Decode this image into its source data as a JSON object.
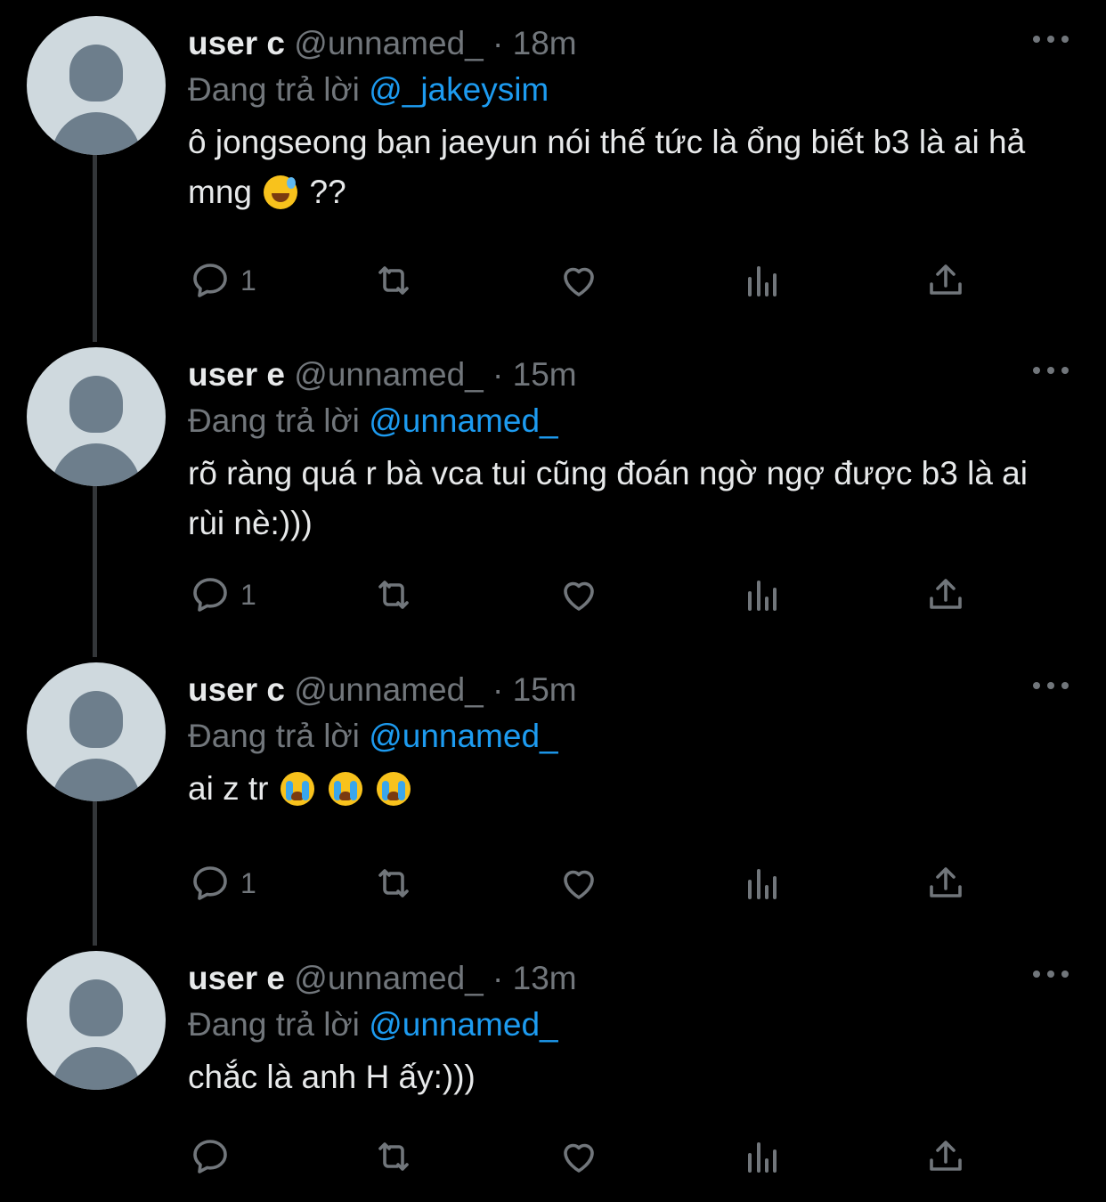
{
  "theme": {
    "background": "#000000",
    "text": "#e7e9ea",
    "muted": "#71767b",
    "accent": "#1d9bf0",
    "thread_line": "#333639"
  },
  "tweets": [
    {
      "name": "user c",
      "handle": "@unnamed_",
      "sep": "·",
      "time": "18m",
      "reply_prefix": "Đang trả lời",
      "reply_to": "@_jakeysim",
      "text": "ô jongseong bạn jaeyun nói thế tức là ổng biết b3 là ai hả mng",
      "emoji": [
        "sweat-smile-emoji"
      ],
      "text_suffix": "??",
      "reply_count": "1",
      "icons": [
        "reply-icon",
        "retweet-icon",
        "like-icon",
        "views-icon",
        "share-icon"
      ]
    },
    {
      "name": "user e",
      "handle": "@unnamed_",
      "sep": "·",
      "time": "15m",
      "reply_prefix": "Đang trả lời",
      "reply_to": "@unnamed_",
      "text": "rõ ràng quá r bà vca tui cũng đoán ngờ ngợ được b3 là ai rùi nè:)))",
      "reply_count": "1"
    },
    {
      "name": "user c",
      "handle": "@unnamed_",
      "sep": "·",
      "time": "15m",
      "reply_prefix": "Đang trả lời",
      "reply_to": "@unnamed_",
      "text": "ai z tr",
      "emoji": [
        "crying-emoji",
        "crying-emoji",
        "crying-emoji"
      ],
      "reply_count": "1"
    },
    {
      "name": "user e",
      "handle": "@unnamed_",
      "sep": "·",
      "time": "13m",
      "reply_prefix": "Đang trả lời",
      "reply_to": "@unnamed_",
      "text": "chắc là anh H ấy:)))",
      "reply_count": ""
    }
  ]
}
